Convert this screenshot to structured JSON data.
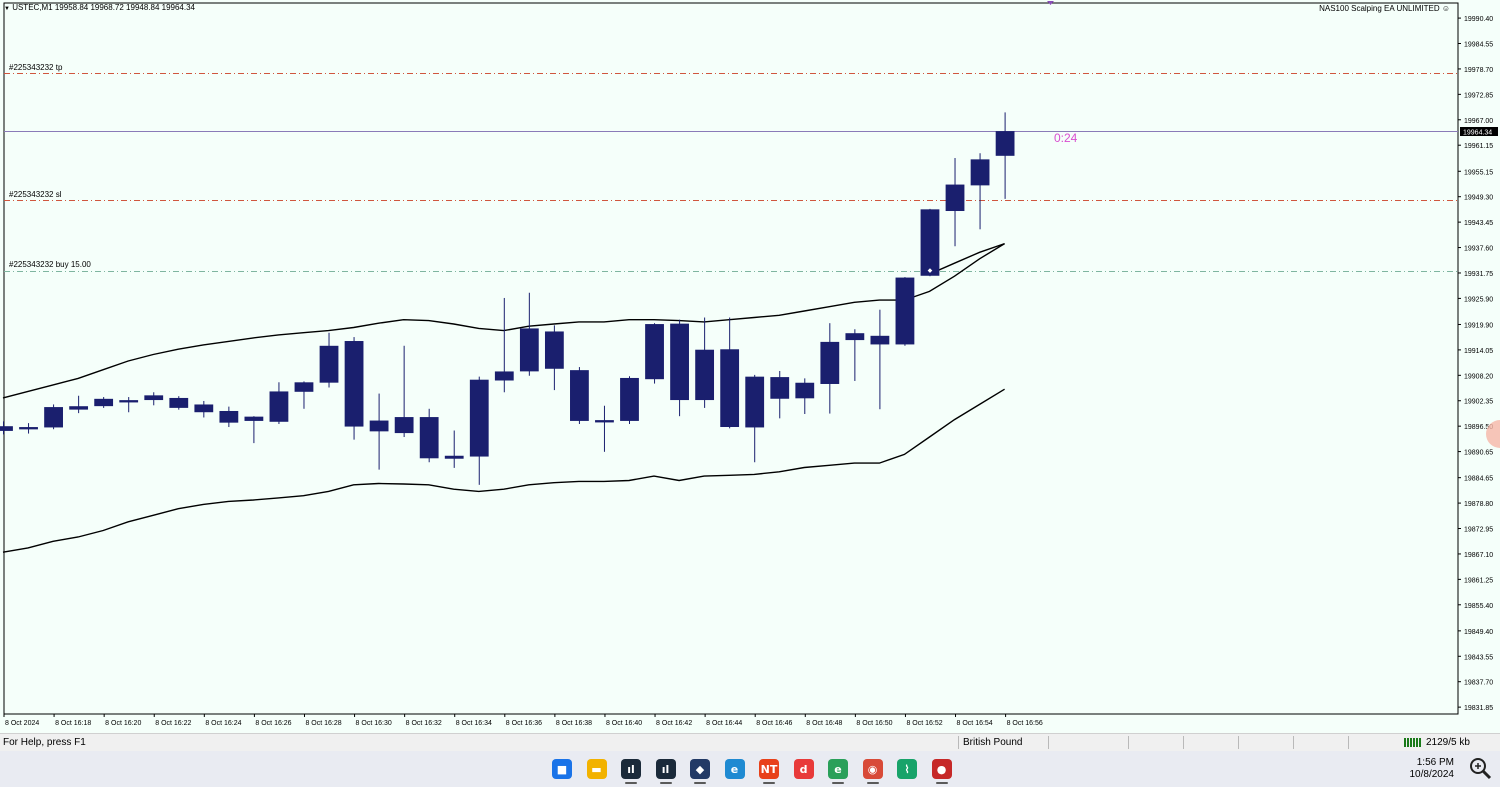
{
  "header": {
    "symbol_info": "USTEC,M1  19958.84 19968.72 19948.84 19964.34",
    "ea_label": "NAS100 Scalping EA UNLIMITED"
  },
  "countdown": "0:24",
  "order_lines": [
    {
      "label": "#225343232 tp",
      "price": 19977.7,
      "color": "#d0563e"
    },
    {
      "label": "#225343232 sl",
      "price": 19948.5,
      "color": "#d0563e"
    },
    {
      "label": "#225343232 buy 15.00",
      "price": 19932.3,
      "color": "#7fb5a0"
    }
  ],
  "current_price": {
    "label": "19964.34",
    "value": 19964.34,
    "color": "#8a7bb8"
  },
  "price_axis": [
    "19990.40",
    "19984.55",
    "19978.70",
    "19972.85",
    "19967.00",
    "19961.15",
    "19955.15",
    "19949.30",
    "19943.45",
    "19937.60",
    "19931.75",
    "19925.90",
    "19919.90",
    "19914.05",
    "19908.20",
    "19902.35",
    "19896.50",
    "19890.65",
    "19884.65",
    "19878.80",
    "19872.95",
    "19867.10",
    "19861.25",
    "19855.40",
    "19849.40",
    "19843.55",
    "19837.70",
    "19831.85"
  ],
  "time_axis": [
    "8 Oct 2024",
    "8 Oct 16:18",
    "8 Oct 16:20",
    "8 Oct 16:22",
    "8 Oct 16:24",
    "8 Oct 16:26",
    "8 Oct 16:28",
    "8 Oct 16:30",
    "8 Oct 16:32",
    "8 Oct 16:34",
    "8 Oct 16:36",
    "8 Oct 16:38",
    "8 Oct 16:40",
    "8 Oct 16:42",
    "8 Oct 16:44",
    "8 Oct 16:46",
    "8 Oct 16:48",
    "8 Oct 16:50",
    "8 Oct 16:52",
    "8 Oct 16:54",
    "8 Oct 16:56"
  ],
  "chart_data": {
    "type": "candlestick",
    "symbol": "USTEC",
    "timeframe": "M1",
    "ylim": [
      19830.5,
      19991.8
    ],
    "candle_color": "#1a1f6e",
    "band_color": "#000000",
    "candles": [
      {
        "o": 19896.4,
        "h": 19897.6,
        "l": 19894.6,
        "c": 19895.5
      },
      {
        "o": 19896.0,
        "h": 19897.2,
        "l": 19894.8,
        "c": 19896.2
      },
      {
        "o": 19896.3,
        "h": 19901.5,
        "l": 19895.8,
        "c": 19900.8
      },
      {
        "o": 19900.4,
        "h": 19903.5,
        "l": 19899.5,
        "c": 19901.0
      },
      {
        "o": 19901.2,
        "h": 19903.2,
        "l": 19900.7,
        "c": 19902.7
      },
      {
        "o": 19902.3,
        "h": 19903.2,
        "l": 19899.7,
        "c": 19902.4
      },
      {
        "o": 19902.6,
        "h": 19904.3,
        "l": 19901.3,
        "c": 19903.5
      },
      {
        "o": 19902.9,
        "h": 19903.4,
        "l": 19900.3,
        "c": 19900.8
      },
      {
        "o": 19901.4,
        "h": 19902.3,
        "l": 19898.5,
        "c": 19899.8
      },
      {
        "o": 19899.9,
        "h": 19901.0,
        "l": 19896.3,
        "c": 19897.4
      },
      {
        "o": 19897.8,
        "h": 19898.8,
        "l": 19892.6,
        "c": 19898.6
      },
      {
        "o": 19897.6,
        "h": 19906.6,
        "l": 19897.0,
        "c": 19904.4
      },
      {
        "o": 19904.5,
        "h": 19906.8,
        "l": 19900.5,
        "c": 19906.5
      },
      {
        "o": 19906.6,
        "h": 19918.0,
        "l": 19905.4,
        "c": 19914.9
      },
      {
        "o": 19916.0,
        "h": 19917.0,
        "l": 19893.4,
        "c": 19896.5
      },
      {
        "o": 19895.4,
        "h": 19904.0,
        "l": 19886.5,
        "c": 19897.7
      },
      {
        "o": 19895.0,
        "h": 19915.0,
        "l": 19894.0,
        "c": 19898.5
      },
      {
        "o": 19898.5,
        "h": 19900.5,
        "l": 19888.2,
        "c": 19889.2
      },
      {
        "o": 19889.6,
        "h": 19895.5,
        "l": 19886.9,
        "c": 19889.1
      },
      {
        "o": 19889.6,
        "h": 19907.9,
        "l": 19883.0,
        "c": 19907.1
      },
      {
        "o": 19907.1,
        "h": 19926.0,
        "l": 19904.3,
        "c": 19909.0
      },
      {
        "o": 19909.2,
        "h": 19927.2,
        "l": 19908.1,
        "c": 19918.9
      },
      {
        "o": 19918.2,
        "h": 19919.7,
        "l": 19904.8,
        "c": 19909.8
      },
      {
        "o": 19909.3,
        "h": 19910.1,
        "l": 19897.0,
        "c": 19897.8
      },
      {
        "o": 19897.8,
        "h": 19901.2,
        "l": 19890.6,
        "c": 19897.5
      },
      {
        "o": 19897.8,
        "h": 19908.0,
        "l": 19897.0,
        "c": 19907.5
      },
      {
        "o": 19907.4,
        "h": 19920.2,
        "l": 19906.3,
        "c": 19919.9
      },
      {
        "o": 19920.0,
        "h": 19921.0,
        "l": 19898.8,
        "c": 19902.6
      },
      {
        "o": 19902.6,
        "h": 19921.5,
        "l": 19900.7,
        "c": 19914.0
      },
      {
        "o": 19914.1,
        "h": 19921.5,
        "l": 19896.0,
        "c": 19896.4
      },
      {
        "o": 19896.3,
        "h": 19908.3,
        "l": 19888.2,
        "c": 19907.8
      },
      {
        "o": 19907.7,
        "h": 19909.2,
        "l": 19898.3,
        "c": 19902.9
      },
      {
        "o": 19903.0,
        "h": 19907.5,
        "l": 19899.3,
        "c": 19906.4
      },
      {
        "o": 19906.3,
        "h": 19920.2,
        "l": 19899.4,
        "c": 19915.8
      },
      {
        "o": 19916.4,
        "h": 19918.8,
        "l": 19906.9,
        "c": 19917.8
      },
      {
        "o": 19917.2,
        "h": 19923.3,
        "l": 19900.4,
        "c": 19915.4
      },
      {
        "o": 19915.4,
        "h": 19930.8,
        "l": 19915.0,
        "c": 19930.6
      },
      {
        "o": 19931.2,
        "h": 19946.5,
        "l": 19931.0,
        "c": 19946.3
      },
      {
        "o": 19946.1,
        "h": 19958.2,
        "l": 19937.9,
        "c": 19952.0
      },
      {
        "o": 19952.0,
        "h": 19959.3,
        "l": 19941.8,
        "c": 19957.8
      },
      {
        "o": 19958.8,
        "h": 19968.7,
        "l": 19948.8,
        "c": 19964.3
      }
    ],
    "upper_band": [
      19903,
      19904.5,
      19906,
      19907.5,
      19909.5,
      19911.5,
      19913,
      19914.2,
      19915.2,
      19916,
      19916.8,
      19917.5,
      19918,
      19918.5,
      19919.2,
      19920.2,
      19921,
      19920.8,
      19920,
      19919,
      19918.5,
      19919.5,
      19920,
      19920.5,
      19920.5,
      19921,
      19921,
      19920.8,
      19920.5,
      19921,
      19921.5,
      19922,
      19923,
      19924,
      19925,
      19925.5,
      19925.5,
      19927.5,
      19931,
      19935,
      19938.5
    ],
    "middle_band": [
      null,
      null,
      null,
      null,
      null,
      null,
      null,
      null,
      null,
      null,
      null,
      null,
      null,
      null,
      null,
      null,
      null,
      null,
      null,
      null,
      null,
      null,
      null,
      null,
      null,
      null,
      null,
      null,
      null,
      null,
      null,
      null,
      null,
      null,
      null,
      null,
      null,
      19931.5,
      19934,
      19936.5,
      19938.5
    ],
    "lower_band": [
      19867.5,
      19868.5,
      19870,
      19871,
      19872.5,
      19874.5,
      19876,
      19877.5,
      19878.5,
      19879.2,
      19879.5,
      19880,
      19880.5,
      19881.5,
      19883,
      19883.3,
      19883.2,
      19883,
      19882,
      19881.5,
      19882,
      19883,
      19883.5,
      19883.8,
      19883.8,
      19884,
      19885,
      19884,
      19885,
      19885.2,
      19885.4,
      19886,
      19887,
      19887.5,
      19888,
      19888,
      19890,
      19894,
      19898,
      19901.5,
      19905
    ]
  },
  "status_bar": {
    "help_text": "For Help, press F1",
    "currency": "British Pound",
    "traffic": "2129/5 kb"
  },
  "taskbar": {
    "icons": [
      {
        "name": "windows-start-icon",
        "color": "#1a73e8",
        "glyph": "■"
      },
      {
        "name": "file-explorer-icon",
        "color": "#f2b200",
        "glyph": "▬"
      },
      {
        "name": "metatrader-icon",
        "color": "#1b2a3a",
        "glyph": "ıl"
      },
      {
        "name": "metatrader-second-icon",
        "color": "#1b2a3a",
        "glyph": "ıl"
      },
      {
        "name": "chat-app-icon",
        "color": "#233a66",
        "glyph": "◆"
      },
      {
        "name": "edge-browser-icon",
        "color": "#1f8ad2",
        "glyph": "e"
      },
      {
        "name": "ninjatrader-icon",
        "color": "#e8411a",
        "glyph": "NT"
      },
      {
        "name": "music-app-icon",
        "color": "#e83a3a",
        "glyph": "d"
      },
      {
        "name": "edge-alt-icon",
        "color": "#2aa05a",
        "glyph": "e"
      },
      {
        "name": "chrome-icon",
        "color": "#d84a38",
        "glyph": "◉"
      },
      {
        "name": "tradingview-icon",
        "color": "#18a36a",
        "glyph": "⌇"
      },
      {
        "name": "screen-recorder-icon",
        "color": "#c62828",
        "glyph": "●"
      }
    ],
    "time": "1:56 PM",
    "date": "10/8/2024"
  }
}
